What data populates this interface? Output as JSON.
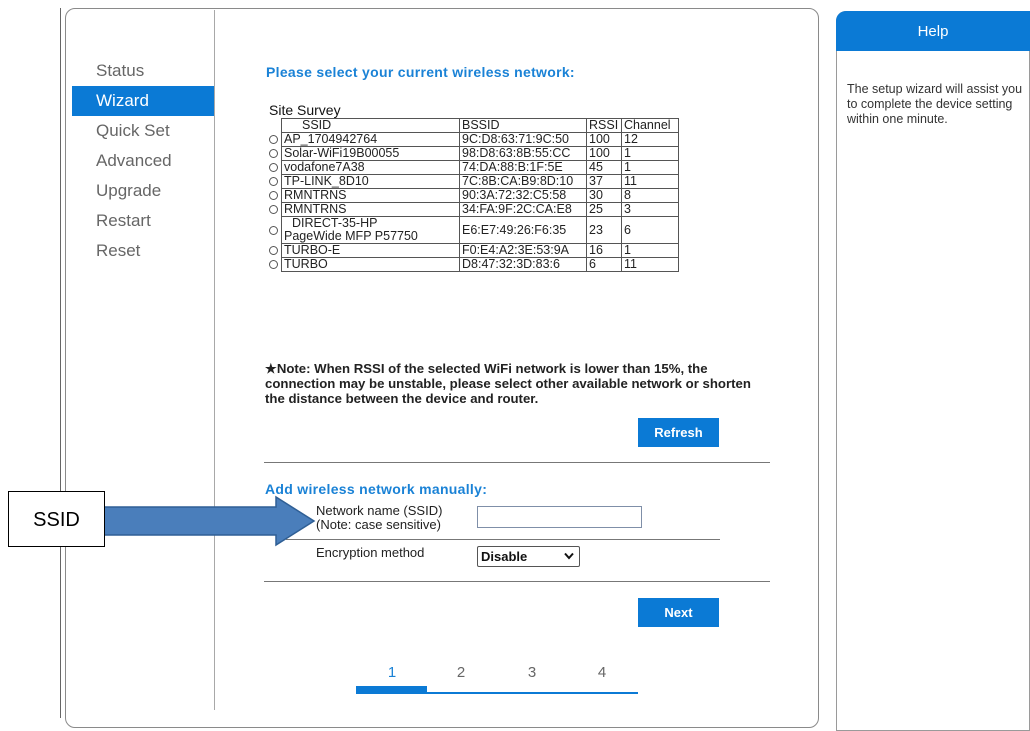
{
  "sidebar": {
    "items": [
      {
        "label": "Status",
        "active": false
      },
      {
        "label": "Wizard",
        "active": true
      },
      {
        "label": "Quick Set",
        "active": false
      },
      {
        "label": "Advanced",
        "active": false
      },
      {
        "label": "Upgrade",
        "active": false
      },
      {
        "label": "Restart",
        "active": false
      },
      {
        "label": "Reset",
        "active": false
      }
    ]
  },
  "main": {
    "select_title": "Please select your current wireless network:",
    "survey_title": "Site Survey",
    "columns": [
      "SSID",
      "BSSID",
      "RSSI",
      "Channel"
    ],
    "networks": [
      {
        "ssid": "AP_1704942764",
        "bssid": "9C:D8:63:71:9C:50",
        "rssi": "100",
        "channel": "12"
      },
      {
        "ssid": "Solar-WiFi19B00055",
        "bssid": "98:D8:63:8B:55:CC",
        "rssi": "100",
        "channel": "1"
      },
      {
        "ssid": "vodafone7A38",
        "bssid": "74:DA:88:B:1F:5E",
        "rssi": "45",
        "channel": "1"
      },
      {
        "ssid": "TP-LINK_8D10",
        "bssid": "7C:8B:CA:B9:8D:10",
        "rssi": "37",
        "channel": "11"
      },
      {
        "ssid": "RMNTRNS",
        "bssid": "90:3A:72:32:C5:58",
        "rssi": "30",
        "channel": "8"
      },
      {
        "ssid": "RMNTRNS",
        "bssid": "34:FA:9F:2C:CA:E8",
        "rssi": "25",
        "channel": "3"
      },
      {
        "ssid_line1": "DIRECT-35-HP",
        "ssid_line2": "PageWide MFP P57750",
        "bssid": "E6:E7:49:26:F6:35",
        "rssi": "23",
        "channel": "6"
      },
      {
        "ssid": "TURBO-E",
        "bssid": "F0:E4:A2:3E:53:9A",
        "rssi": "16",
        "channel": "1"
      },
      {
        "ssid": "TURBO",
        "bssid": "D8:47:32:3D:83:6",
        "rssi": "6",
        "channel": "11"
      }
    ],
    "note": "★Note: When RSSI of the selected WiFi network is lower than 15%, the connection may be unstable, please select other available network or shorten the distance between the device and router.",
    "refresh_label": "Refresh",
    "manual_title": "Add wireless network manually:",
    "ssid_label_line1": "Network name (SSID)",
    "ssid_label_line2": "(Note: case sensitive)",
    "ssid_value": "",
    "encryption_label": "Encryption method",
    "encryption_value": "Disable",
    "next_label": "Next",
    "steps": [
      "1",
      "2",
      "3",
      "4"
    ],
    "active_step": 1
  },
  "help": {
    "title": "Help",
    "text": "The setup wizard will assist you to complete the device setting within one minute."
  },
  "callout": {
    "label": "SSID",
    "arrow_color": "#4a7ebb"
  },
  "colors": {
    "accent": "#0b7ad5",
    "title_blue": "#1a82d6"
  }
}
